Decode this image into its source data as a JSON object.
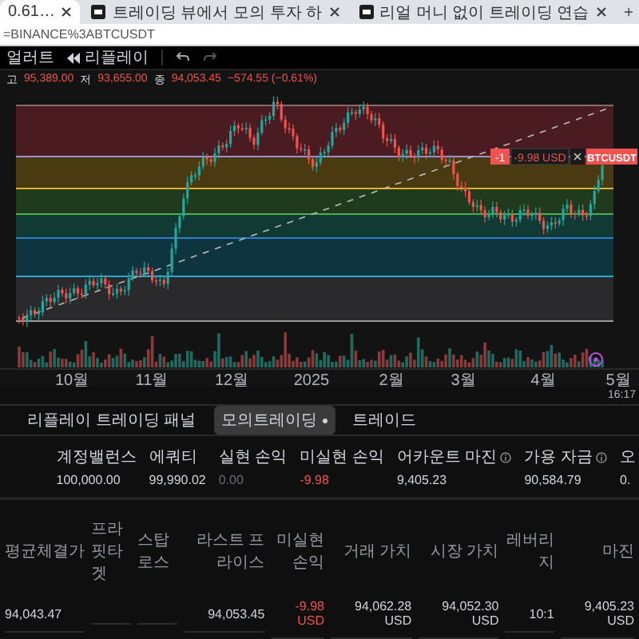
{
  "browser_tabs": [
    {
      "title": "0.61…",
      "icon": false,
      "selected": true
    },
    {
      "title": "트레이딩 뷰에서 모의 투자 하",
      "icon": true,
      "selected": false
    },
    {
      "title": "리얼 머니 없이 트레이딩 연습",
      "icon": true,
      "selected": false
    }
  ],
  "address": "=BINANCE%3ABTCUSDT",
  "toolbar": [
    "얼러트",
    "리플레이"
  ],
  "quote": [
    {
      "label": "고",
      "value": "95,389.00"
    },
    {
      "label": "저",
      "value": "93,655.00"
    },
    {
      "label": "종",
      "value": "94,053.45"
    }
  ],
  "quote_change": "−574.55 (−0.61%)",
  "position_label": {
    "quantity": "-1",
    "pnl": "-9.98 USD",
    "symbol": "BTCUSDT"
  },
  "time_axis": [
    "10월",
    "11월",
    "12월",
    "2025",
    "2월",
    "3월",
    "4월",
    "5월"
  ],
  "clock": "16:17",
  "panel_tabs": [
    {
      "label": "리플레이 트레이딩 패널",
      "selected": false,
      "dot": false
    },
    {
      "label": "모의트레이딩",
      "selected": true,
      "dot": true
    },
    {
      "label": "트레이드",
      "selected": false,
      "dot": false
    }
  ],
  "account": [
    {
      "label": "계정밸런스",
      "value": "100,000.00",
      "kind": "normal",
      "info": false
    },
    {
      "label": "에쿼티",
      "value": "99,990.02",
      "kind": "normal",
      "info": false
    },
    {
      "label": "실현 손익",
      "value": "0.00",
      "kind": "muted",
      "info": false
    },
    {
      "label": "미실현 손익",
      "value": "-9.98",
      "kind": "negative",
      "info": false
    },
    {
      "label": "어카운트 마진",
      "value": "9,405.23",
      "kind": "normal",
      "info": true
    },
    {
      "label": "가용 자금",
      "value": "90,584.79",
      "kind": "normal",
      "info": true
    },
    {
      "label": "오",
      "value": "0.",
      "kind": "normal",
      "info": false
    }
  ],
  "positions": {
    "columns": [
      "평균체결가",
      "프라핏타겟",
      "스탑로스",
      "라스트 프라이스",
      "미실현 손익",
      "거래 가치",
      "시장 가치",
      "레버리지",
      "마진"
    ],
    "rows": [
      {
        "cells": [
          "94,043.47",
          null,
          null,
          "94,053.45",
          "-9.98 USD",
          "94,062.28 USD",
          "94,052.30 USD",
          "10:1",
          "9,405.23 USD"
        ],
        "pnl_negative": true
      }
    ]
  }
}
